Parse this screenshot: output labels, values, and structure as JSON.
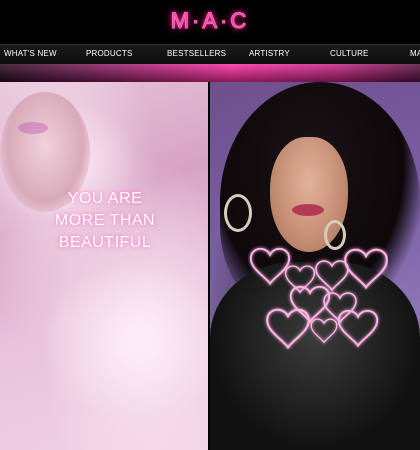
{
  "brand": {
    "logo_text": "M·A·C",
    "accent_color": "#ff2f9a"
  },
  "nav": {
    "items": [
      {
        "label": "WHAT'S NEW"
      },
      {
        "label": "PRODUCTS"
      },
      {
        "label": "BESTSELLERS"
      },
      {
        "label": "ARTISTRY"
      },
      {
        "label": "CULTURE"
      },
      {
        "label": "MA"
      }
    ]
  },
  "hero_left": {
    "tagline": [
      "YOU ARE",
      "MORE THAN",
      "BEAUTIFUL"
    ],
    "image_subject": "model-pink-tulle"
  },
  "hero_right": {
    "image_subject": "model-neon-hearts",
    "decoration": "neon-hearts-icon"
  }
}
